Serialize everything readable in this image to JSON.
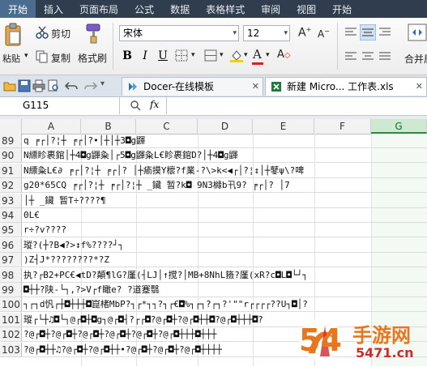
{
  "menu": [
    "开始",
    "插入",
    "页面布局",
    "公式",
    "数据",
    "表格样式",
    "审阅",
    "视图",
    "开始"
  ],
  "ribbon": {
    "paste_label": "粘贴",
    "cut_label": "剪切",
    "copy_label": "复制",
    "format_painter_label": "格式刷",
    "font_name": "宋体",
    "font_size": "12",
    "bold": "B",
    "italic": "I",
    "underline": "U",
    "merge_label": "合并居"
  },
  "tabs": [
    {
      "label": "Docer-在线模板"
    },
    {
      "label": "新建 Micro... 工作表.xls"
    }
  ],
  "formula_bar": {
    "cell_ref": "G115",
    "fx": "fx",
    "content": ""
  },
  "columns": [
    "A",
    "B",
    "C",
    "D",
    "E",
    "F",
    "G"
  ],
  "rows": [
    {
      "n": "89",
      "text": "q           ╒┌│?¦┼     ╒┌│?•│┼│┼3◘g鼲"
    },
    {
      "n": "90",
      "text": "N縹眕裹錧│┼4◘g鼲粂│┌5◘g鼲粂L€眕裹錧D?│┼4◘g鼲"
    },
    {
      "n": "91",
      "text": "N縹粂L€∂      ╒┌│?¦┼     ╒┌│?      │┼瘉摸Y櫰?f業-?\\>k<◀┌│?¦↕│┼鼕ψ\\?啤"
    },
    {
      "n": "92",
      "text": "g20*65CQ      ╒┌│?¦┼     ╒┌│?¦┼ _鑶 暂?k◘   9N3櫞b卂9?    ╒┌│?    │7"
    },
    {
      "n": "93",
      "text": "│┼ _鑶 暂T÷????¶"
    },
    {
      "n": "94",
      "text": "0L€"
    },
    {
      "n": "95",
      "text": "r÷?v????"
    },
    {
      "n": "96",
      "text": "瑽?(┼?B◀?>↕f%????┘┐"
    },
    {
      "n": "97",
      "text": ")Z┤J*????????*?Z"
    },
    {
      "n": "98",
      "text": "执?┌B2+PC€◀tD?顛¶lG?厪(┤LJ│↑搅?│MB+8NhL籡?厪(xR?c◘L◘└┘┐"
    },
    {
      "n": "99",
      "text": "            ◘┼┼?陕-└┐,?>V┌f瞰e? ?道蹇翳"
    },
    {
      "n": "100",
      "text": "┐┌┐d忛┌┼◘┼┼┼◘崑楮MbP?┐┌*┐┐?┐┌€◘%┐┌┐?┌┐?'\"\"r┌┌┌┌??U┐◘│?"
    },
    {
      "n": "101",
      "text": "瑽┌└┼♫◘└┐@┌◘┼◘g┐@┌◘┤?┌┌◘?@┌◘┼?@┌◘┼┼◘?@┌◘┼┼┼◘?"
    },
    {
      "n": "102",
      "text": "            ?@┌◘┼?@┌◘┼?@┌◘┼?@┌◘┼?@┌◘┼?@┌◘┼┼┼◘┼┼┼"
    },
    {
      "n": "103",
      "text": "            ?@┌◘┼┼♫?@┌◘┼?@┌◘┼┼•?@┌◘┼?@┌◘┼?@┌◘┼┼┼┼"
    }
  ],
  "watermark": {
    "text": "手游网",
    "digits": "54",
    "sub": "5471.cn"
  },
  "colors": {
    "menubar": "#2f3d4f",
    "menu_active": "#4a6d8f",
    "selected_column": "#cfe8d2",
    "watermark_orange": "#e8761e",
    "watermark_red": "#d12a2a"
  }
}
